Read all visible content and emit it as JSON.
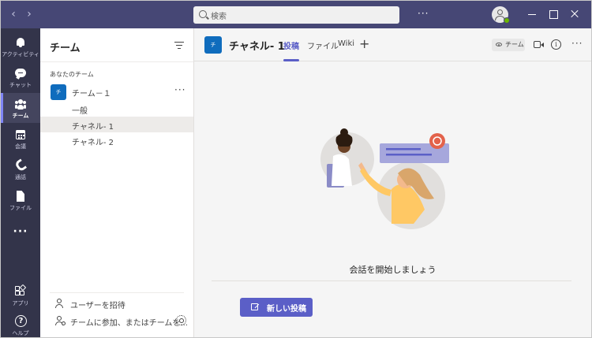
{
  "titlebar": {
    "back_icon": "chevron-left-icon",
    "forward_icon": "chevron-right-icon",
    "search_placeholder": "検索",
    "more_label": "···"
  },
  "appbar": {
    "items": [
      {
        "label": "アクティビティ",
        "icon": "bell-icon"
      },
      {
        "label": "チャット",
        "icon": "chat-icon"
      },
      {
        "label": "チーム",
        "icon": "teams-icon"
      },
      {
        "label": "会議",
        "icon": "calendar-icon"
      },
      {
        "label": "通話",
        "icon": "phone-icon"
      },
      {
        "label": "ファイル",
        "icon": "file-icon"
      }
    ],
    "more": "···",
    "apps_label": "アプリ",
    "help_label": "ヘルプ",
    "help_glyph": "?"
  },
  "teams_panel": {
    "title": "チーム",
    "section_label": "あなたのチーム",
    "team": {
      "avatar": "チ",
      "name": "チーム－１",
      "more": "···"
    },
    "channels": [
      {
        "name": "一般",
        "active": false
      },
      {
        "name": "チャネル- 1",
        "active": true
      },
      {
        "name": "チャネル- 2",
        "active": false
      }
    ],
    "footer": {
      "invite": "ユーザーを招待",
      "join": "チームに参加、またはチームを..."
    }
  },
  "main": {
    "channel_avatar": "チ",
    "channel_title": "チャネル- 1",
    "tabs": [
      {
        "label": "投稿",
        "active": true
      },
      {
        "label": "ファイル",
        "active": false
      },
      {
        "label": "Wiki",
        "active": false
      }
    ],
    "add_tab": "+",
    "team_chip": "チーム",
    "info_glyph": "i",
    "more": "···",
    "empty_title": "会話を開始しましょう",
    "new_post_button": "新しい投稿"
  },
  "colors": {
    "titlebar": "#464775",
    "appbar": "#33344a",
    "accent": "#5b5fc7",
    "team_avatar": "#0f6cbd",
    "presence": "#6bb700"
  }
}
